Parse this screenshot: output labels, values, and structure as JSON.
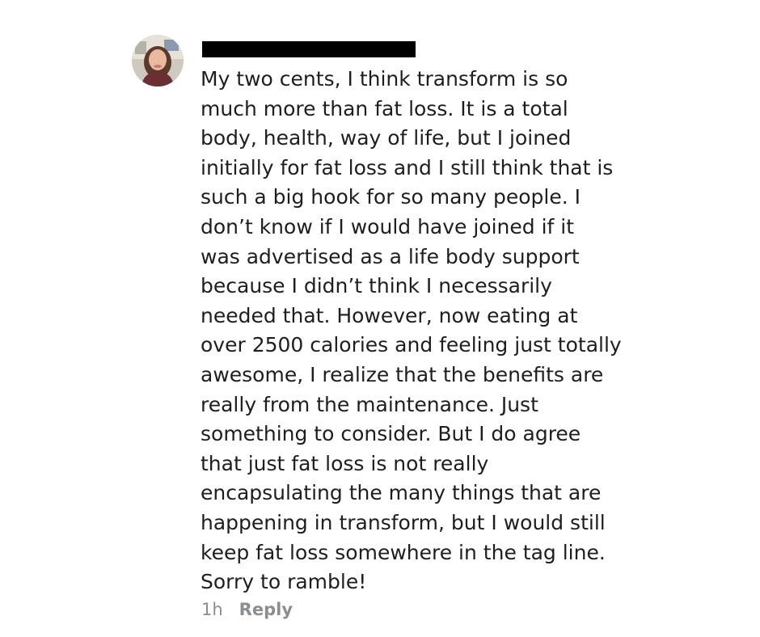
{
  "comment": {
    "avatar_icon": "user-avatar-photo",
    "author_redacted": true,
    "text_lines": [
      "My two cents, I think transform is so",
      "much more than fat loss. It is a total",
      "body, health, way of life, but I joined",
      "initially for fat loss and I still think that is",
      "such a big hook for so many people. I",
      "don’t know if I would have joined if it",
      "was advertised as a life body support",
      "because I didn’t think I necessarily",
      "needed that. However, now eating at",
      "over 2500 calories and feeling just totally",
      "awesome, I realize that the benefits are",
      "really from the maintenance. Just",
      "something to consider. But I do agree",
      "that just fat loss is not really",
      "encapsulating the many things that are",
      "happening in transform, but I would still",
      "keep fat loss somewhere in the tag line.",
      "Sorry to ramble!"
    ],
    "timestamp": "1h",
    "reply_label": "Reply"
  },
  "colors": {
    "text": "#1c1e21",
    "meta": "#8a8d91",
    "redaction": "#000000"
  }
}
